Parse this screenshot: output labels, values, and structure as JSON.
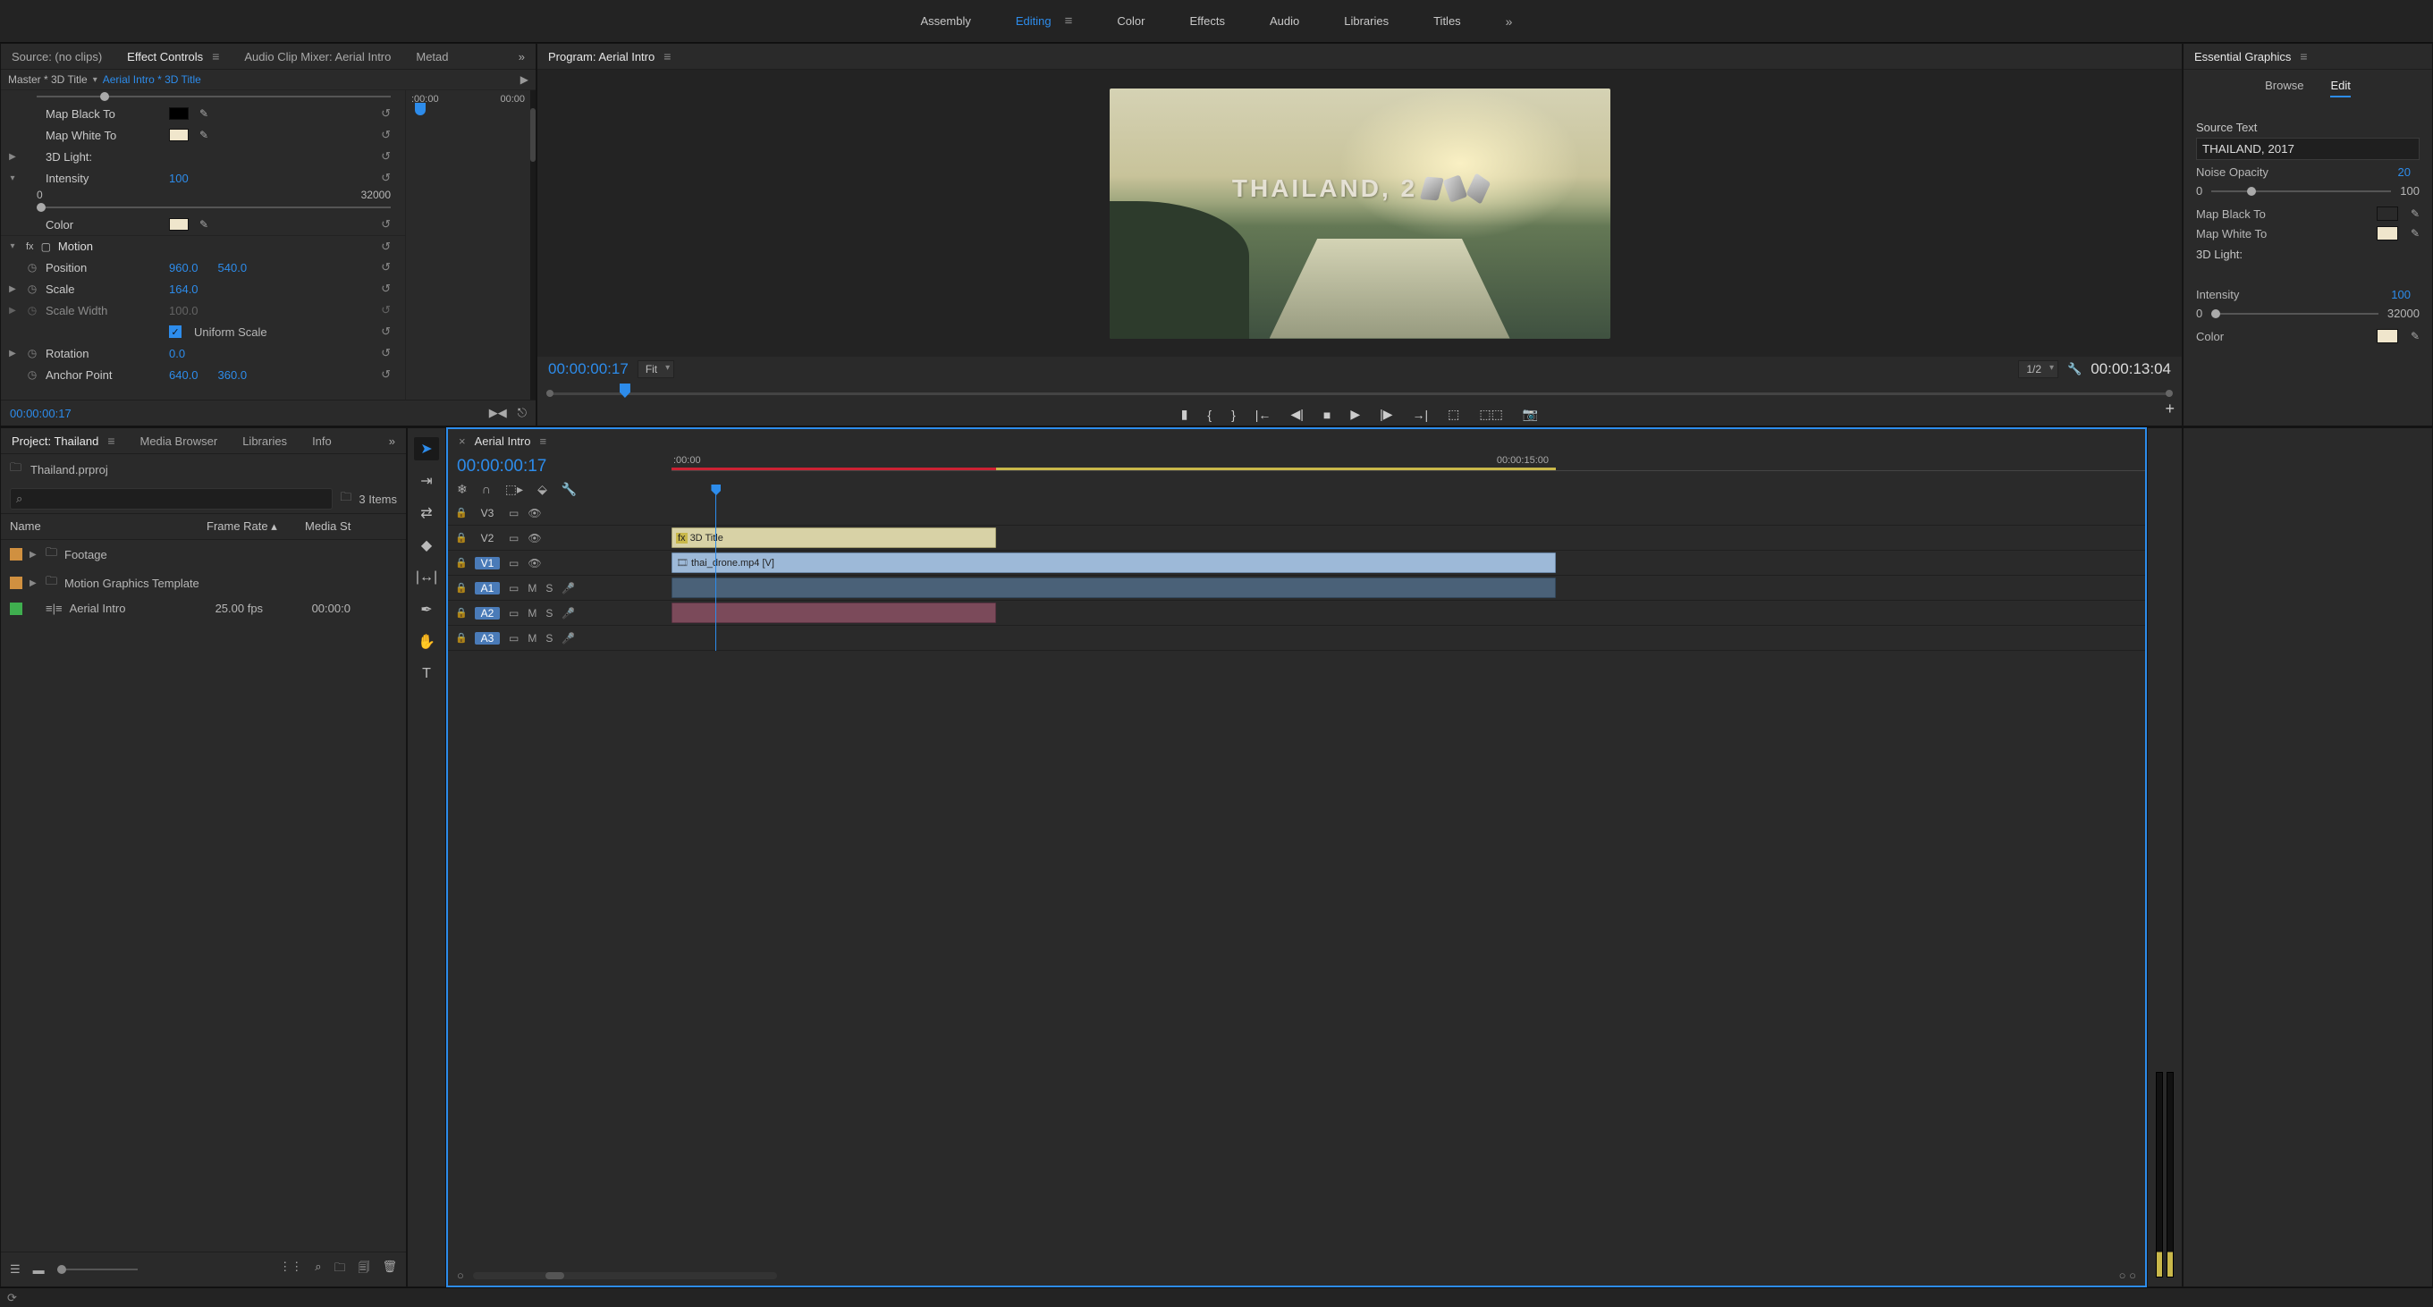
{
  "workspace": {
    "items": [
      "Assembly",
      "Editing",
      "Color",
      "Effects",
      "Audio",
      "Libraries",
      "Titles"
    ],
    "active": 1
  },
  "source_tabs": {
    "items": [
      "Source: (no clips)",
      "Effect Controls",
      "Audio Clip Mixer: Aerial Intro",
      "Metad"
    ],
    "active": 1
  },
  "effect_controls": {
    "master": "Master * 3D Title",
    "clip": "Aerial Intro * 3D Title",
    "ruler": {
      "t0": ":00:00",
      "t1": "00:00"
    },
    "props": {
      "map_black": "Map Black To",
      "map_white": "Map White To",
      "light": "3D Light:",
      "intensity_label": "Intensity",
      "intensity_val": "100",
      "int_min": "0",
      "int_max": "32000",
      "color_label": "Color",
      "motion": "Motion",
      "position_label": "Position",
      "pos_x": "960.0",
      "pos_y": "540.0",
      "scale_label": "Scale",
      "scale_val": "164.0",
      "scalew_label": "Scale Width",
      "scalew_val": "100.0",
      "uniform": "Uniform Scale",
      "rotation_label": "Rotation",
      "rotation_val": "0.0",
      "anchor_label": "Anchor Point",
      "anchor_x": "640.0",
      "anchor_y": "360.0"
    },
    "timecode": "00:00:00:17",
    "colors": {
      "black": "#000000",
      "white": "#f0e6cc",
      "color": "#f0e6cc"
    }
  },
  "program": {
    "title": "Program: Aerial Intro",
    "overlay_text": "THAILAND, 2",
    "tc_in": "00:00:00:17",
    "fit": "Fit",
    "res": "1/2",
    "tc_dur": "00:00:13:04"
  },
  "essential_graphics": {
    "title": "Essential Graphics",
    "tabs": [
      "Browse",
      "Edit"
    ],
    "active_tab": 1,
    "source_text_label": "Source Text",
    "source_text": "THAILAND, 2017",
    "noise_label": "Noise Opacity",
    "noise_val": "20",
    "noise_min": "0",
    "noise_max": "100",
    "map_black": "Map Black To",
    "map_white": "Map White To",
    "light": "3D Light:",
    "intensity_label": "Intensity",
    "intensity_val": "100",
    "int_min": "0",
    "int_max": "32000",
    "color_label": "Color",
    "colors": {
      "black": "#000000",
      "white": "#f0e6cc",
      "color": "#f0e6cc"
    }
  },
  "project": {
    "tabs": [
      "Project: Thailand",
      "Media Browser",
      "Libraries",
      "Info"
    ],
    "file": "Thailand.prproj",
    "item_count": "3 Items",
    "cols": [
      "Name",
      "Frame Rate",
      "Media St"
    ],
    "bins": [
      {
        "chip": "#d09040",
        "name": "Footage",
        "hasChildren": true
      },
      {
        "chip": "#d09040",
        "name": "Motion Graphics Template",
        "hasChildren": true
      },
      {
        "chip": "#3fae4f",
        "name": "Aerial Intro",
        "fps": "25.00 fps",
        "start": "00:00:0",
        "isSequence": true
      }
    ]
  },
  "timeline": {
    "name": "Aerial Intro",
    "tc": "00:00:00:17",
    "ruler": {
      "t0": ":00:00",
      "t1": "00:00:15:00"
    },
    "tracks": {
      "v3": "V3",
      "v2": "V2",
      "v1": "V1",
      "a1": "A1",
      "a2": "A2",
      "a3": "A3"
    },
    "clips": {
      "title": "3D Title",
      "video": "thai_drone.mp4 [V]"
    }
  }
}
